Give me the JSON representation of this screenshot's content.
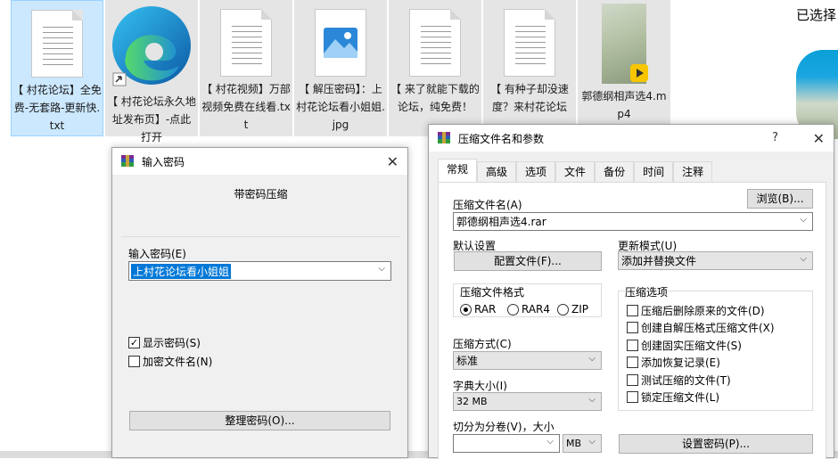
{
  "files": [
    {
      "name": "【 村花论坛】全免费-无套路-更新快.txt",
      "kind": "txt",
      "selected": true
    },
    {
      "name": "【 村花论坛永久地址发布页】-点此打开",
      "kind": "edge-shortcut"
    },
    {
      "name": "【 村花视频】万部视频免费在线看.txt",
      "kind": "txt"
    },
    {
      "name": "【 解压密码】：上村花论坛看小姐姐.jpg",
      "kind": "jpg"
    },
    {
      "name": "【 来了就能下载的论坛，纯免费！",
      "kind": "txt"
    },
    {
      "name": "【 有种子却没速度？来村花论坛",
      "kind": "txt"
    },
    {
      "name": "郭德纲相声选4.mp4",
      "kind": "mp4"
    }
  ],
  "right_panel": {
    "selected_text": "已选择"
  },
  "password_dialog": {
    "title": "输入密码",
    "heading": "带密码压缩",
    "password_label": "输入密码(E)",
    "password_value": "上村花论坛看小姐姐",
    "show_password_label": "显示密码(S)",
    "show_password_checked": true,
    "encrypt_names_label": "加密文件名(N)",
    "encrypt_names_checked": false,
    "organize_button": "整理密码(O)..."
  },
  "archive_dialog": {
    "title": "压缩文件名和参数",
    "help": "?",
    "tabs": [
      "常规",
      "高级",
      "选项",
      "文件",
      "备份",
      "时间",
      "注释"
    ],
    "active_tab": "常规",
    "archive_name_label": "压缩文件名(A)",
    "archive_name_value": "郭德纲相声选4.rar",
    "browse_button": "浏览(B)...",
    "default_settings_label": "默认设置",
    "profiles_button": "配置文件(F)...",
    "update_mode_label": "更新模式(U)",
    "update_mode_value": "添加并替换文件",
    "format_label": "压缩文件格式",
    "formats": [
      "RAR",
      "RAR4",
      "ZIP"
    ],
    "selected_format": "RAR",
    "options_label": "压缩选项",
    "options": [
      {
        "label": "压缩后删除原来的文件(D)",
        "checked": false
      },
      {
        "label": "创建自解压格式压缩文件(X)",
        "checked": false
      },
      {
        "label": "创建固实压缩文件(S)",
        "checked": false
      },
      {
        "label": "添加恢复记录(E)",
        "checked": false
      },
      {
        "label": "测试压缩的文件(T)",
        "checked": false
      },
      {
        "label": "锁定压缩文件(L)",
        "checked": false
      }
    ],
    "method_label": "压缩方式(C)",
    "method_value": "标准",
    "dict_label": "字典大小(I)",
    "dict_value": "32 MB",
    "split_label": "切分为分卷(V)，大小",
    "split_value": "",
    "split_unit": "MB",
    "set_password_button": "设置密码(P)..."
  }
}
